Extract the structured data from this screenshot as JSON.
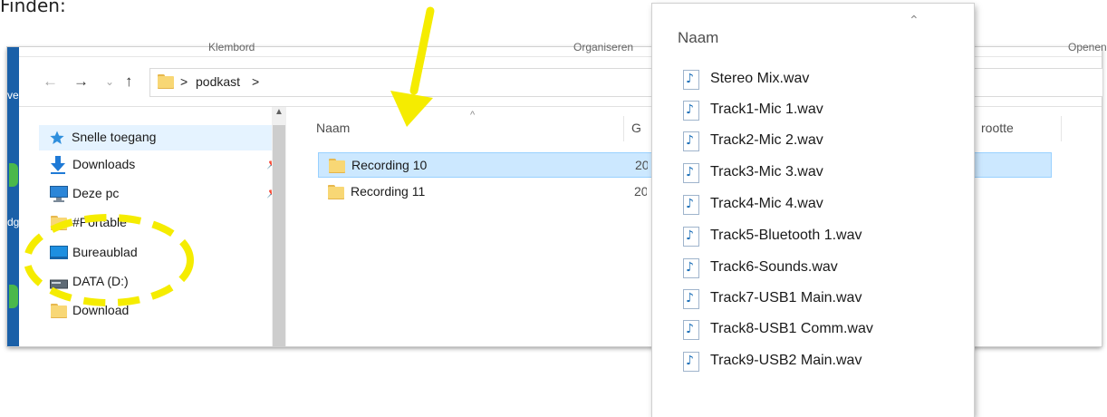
{
  "page_text": "Finden:",
  "explorer": {
    "ribbon_groups": [
      "Klembord",
      "Organiseren",
      "Openen"
    ],
    "nav": {
      "back_icon": "back-arrow-icon",
      "forward_icon": "forward-arrow-icon",
      "recent_icon": "chevron-down-icon",
      "up_icon": "up-arrow-icon"
    },
    "address": {
      "separator": ">",
      "folder": "podkast"
    },
    "sidebar": {
      "items": [
        {
          "label": "Snelle toegang",
          "icon": "star-icon",
          "pinned": false
        },
        {
          "label": "Downloads",
          "icon": "download-arrow-icon",
          "pinned": true
        },
        {
          "label": "Deze pc",
          "icon": "monitor-icon",
          "pinned": true
        },
        {
          "label": "#Portable",
          "icon": "folder-icon",
          "pinned": false
        },
        {
          "label": "Bureaublad",
          "icon": "desktop-icon",
          "pinned": false
        },
        {
          "label": "DATA (D:)",
          "icon": "drive-icon",
          "pinned": false
        },
        {
          "label": "Download",
          "icon": "folder-icon",
          "pinned": false
        }
      ],
      "pin_glyph": "📌"
    },
    "left_edge_fragments": [
      "ve",
      "dg"
    ],
    "columns": [
      {
        "label": "Naam"
      },
      {
        "label": "G"
      },
      {
        "label": "rootte"
      }
    ],
    "files": [
      {
        "name": "Recording 10",
        "date_fragment": "20",
        "selected": true
      },
      {
        "name": "Recording 11",
        "date_fragment": "20",
        "selected": false
      }
    ]
  },
  "popup": {
    "header": "Naam",
    "files": [
      "Stereo Mix.wav",
      "Track1-Mic 1.wav",
      "Track2-Mic 2.wav",
      "Track3-Mic 3.wav",
      "Track4-Mic 4.wav",
      "Track5-Bluetooth 1.wav",
      "Track6-Sounds.wav",
      "Track7-USB1 Main.wav",
      "Track8-USB1 Comm.wav",
      "Track9-USB2 Main.wav"
    ]
  },
  "annotations": {
    "highlight_color": "#f5ec00"
  }
}
